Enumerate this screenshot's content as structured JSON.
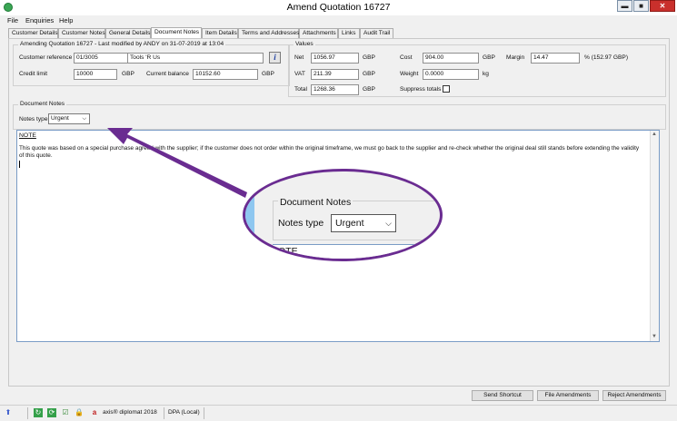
{
  "window": {
    "title": "Amend Quotation 16727",
    "minimize": "▬",
    "maximize": "■",
    "close": "✕"
  },
  "menu": [
    "File",
    "Enquiries",
    "Help"
  ],
  "tabs": [
    "Customer Details",
    "Customer Notes",
    "General Details",
    "Document Notes",
    "Item Details",
    "Terms and Addresses",
    "Attachments",
    "Links",
    "Audit Trail"
  ],
  "active_tab": "Document Notes",
  "amending": {
    "group_label": "Amending Quotation 16727 - Last modified by ANDY on 31-07-2019 at 13:04",
    "customer_reference_label": "Customer reference",
    "customer_reference_value": "01/3005",
    "customer_name_value": "Tools 'R Us",
    "credit_limit_label": "Credit limit",
    "credit_limit_value": "10000",
    "credit_limit_currency": "GBP",
    "current_balance_label": "Current balance",
    "current_balance_value": "10152.60",
    "current_balance_currency": "GBP",
    "info_button": "i"
  },
  "values": {
    "group_label": "Values",
    "net_label": "Net",
    "net_value": "1056.97",
    "net_currency": "GBP",
    "vat_label": "VAT",
    "vat_value": "211.39",
    "vat_currency": "GBP",
    "total_label": "Total",
    "total_value": "1268.36",
    "total_currency": "GBP",
    "cost_label": "Cost",
    "cost_value": "904.00",
    "cost_currency": "GBP",
    "weight_label": "Weight",
    "weight_value": "0.0000",
    "weight_unit": "kg",
    "margin_label": "Margin",
    "margin_value": "14.47",
    "margin_suffix": "% (152.97 GBP)",
    "suppress_totals_label": "Suppress totals"
  },
  "document_notes": {
    "group_label": "Document Notes",
    "notes_type_label": "Notes type",
    "notes_type_value": "Urgent",
    "note_heading": "NOTE",
    "note_text": "This quote was based on a special purchase agreed with the supplier; if the customer does not order within the original timeframe, we must go back to the supplier and re-check whether the original deal still stands before extending the validity of this quote."
  },
  "zoom_callout": {
    "group_label": "Document Notes",
    "notes_type_label": "Notes type",
    "notes_type_value": "Urgent",
    "partial_text": "OTE"
  },
  "buttons": {
    "send_shortcut": "Send Shortcut",
    "file_amendments": "File Amendments",
    "reject_amendments": "Reject Amendments"
  },
  "statusbar": {
    "product": "axis® diplomat 2018",
    "database": "DPA (Local)"
  },
  "colors": {
    "callout": "#6a2c91",
    "accent": "#8ec7f0"
  }
}
